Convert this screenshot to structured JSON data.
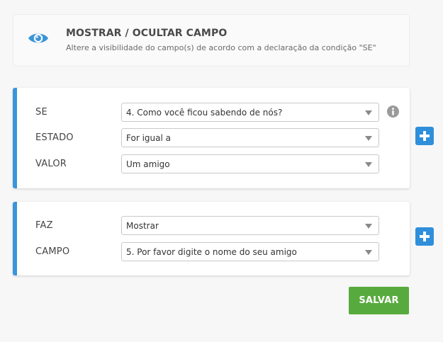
{
  "header": {
    "title": "MOSTRAR / OCULTAR CAMPO",
    "description": "Altere a visibilidade do campo(s) de acordo com a declaração da condição \"SE\"",
    "icon": "eye-icon",
    "icon_color": "#3a95d9"
  },
  "condition": {
    "if_label": "SE",
    "if_value": "4. Como você ficou sabendo de nós?",
    "state_label": "ESTADO",
    "state_value": "For igual a",
    "value_label": "VALOR",
    "value_value": "Um amigo",
    "info_icon": "info-icon"
  },
  "action": {
    "do_label": "FAZ",
    "do_value": "Mostrar",
    "field_label": "CAMPO",
    "field_value": "5. Por favor digite o nome do seu amigo"
  },
  "buttons": {
    "add_icon": "plus-icon",
    "save_label": "SALVAR"
  },
  "colors": {
    "accent": "#3a95d9",
    "add_button": "#2f8fdb",
    "save_button": "#57ab3e"
  }
}
